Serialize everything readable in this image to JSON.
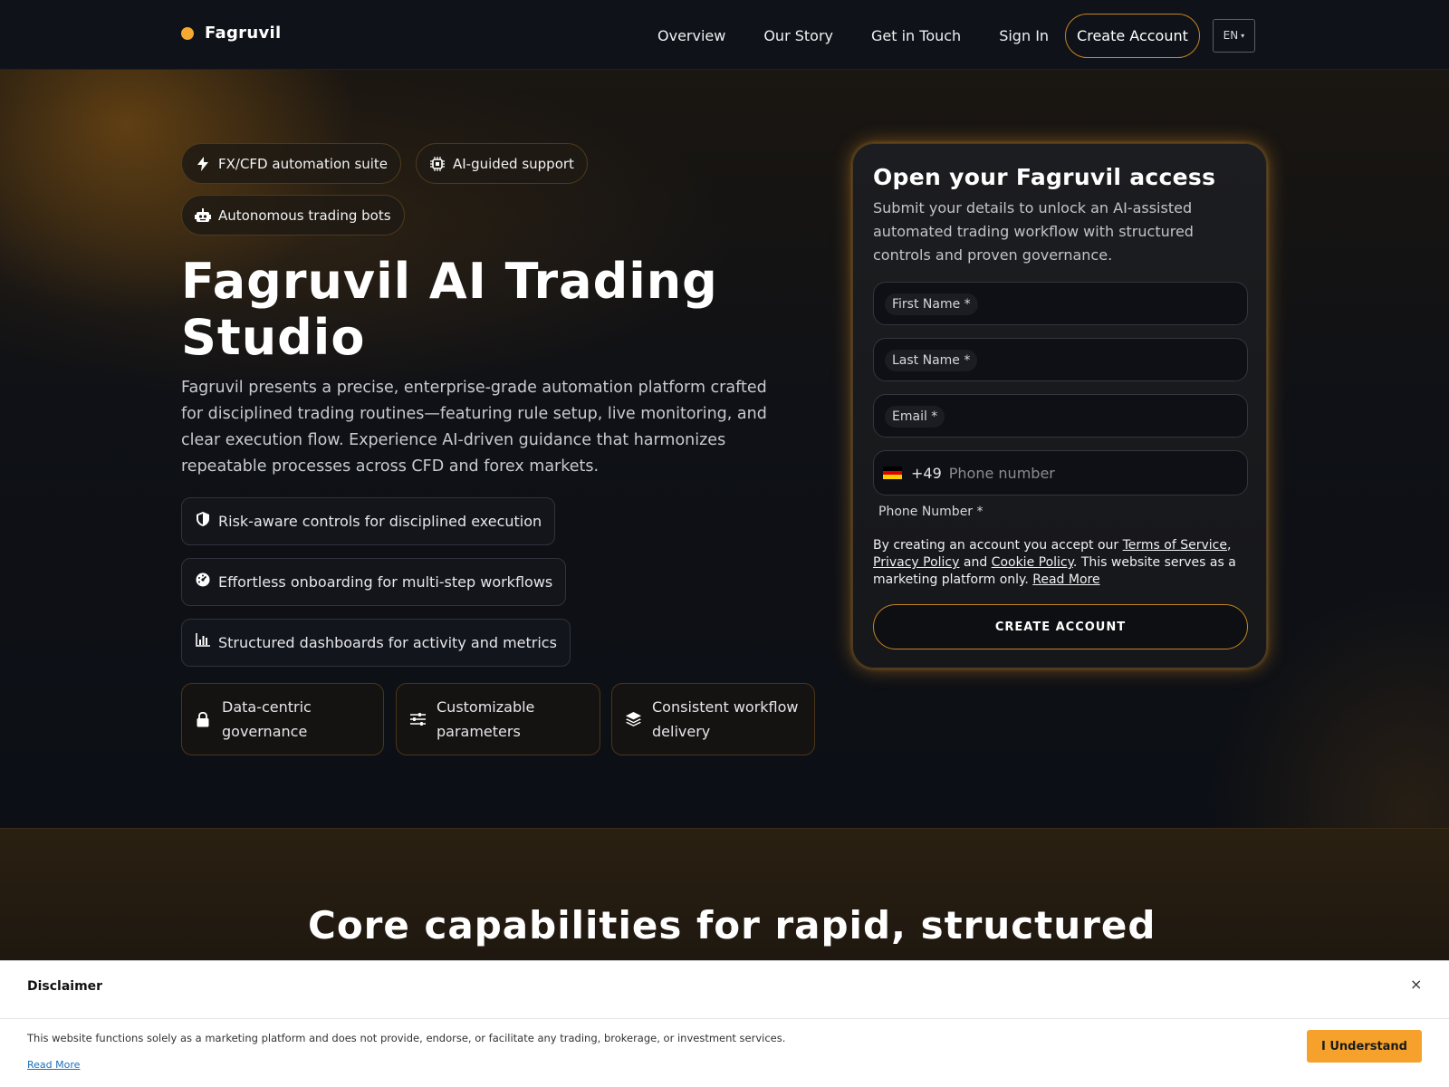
{
  "brand": {
    "name": "Fagruvil",
    "accent": "#f5a832"
  },
  "nav": {
    "links": [
      "Overview",
      "Our Story",
      "Get in Touch",
      "Sign In"
    ],
    "cta": "Create Account",
    "lang": "EN"
  },
  "hero": {
    "chips": [
      {
        "label": "FX/CFD automation suite",
        "icon": "lightning-icon"
      },
      {
        "label": "AI-guided support",
        "icon": "chip-icon"
      },
      {
        "label": "Autonomous trading bots",
        "icon": "robot-icon"
      }
    ],
    "title": "Fagruvil AI Trading Studio",
    "description": "Fagruvil presents a precise, enterprise-grade automation platform crafted for disciplined trading routines—featuring rule setup, live monitoring, and clear execution flow. Experience AI-driven guidance that harmonizes repeatable processes across CFD and forex markets.",
    "features": [
      {
        "label": "Risk-aware controls for disciplined execution",
        "icon": "shield-icon"
      },
      {
        "label": "Effortless onboarding for multi-step workflows",
        "icon": "gauge-icon"
      },
      {
        "label": "Structured dashboards for activity and metrics",
        "icon": "bar-chart-icon"
      }
    ],
    "tiles": [
      {
        "label": "Data-centric governance",
        "icon": "lock-icon"
      },
      {
        "label": "Customizable parameters",
        "icon": "sliders-icon"
      },
      {
        "label": "Consistent workflow delivery",
        "icon": "layers-icon"
      }
    ]
  },
  "form": {
    "title": "Open your Fagruvil access",
    "subtitle": "Submit your details to unlock an AI-assisted automated trading workflow with structured controls and proven governance.",
    "first_name": "First Name *",
    "last_name": "Last Name *",
    "email": "Email *",
    "phone_code": "+49",
    "phone_placeholder": "Phone number",
    "phone_label": "Phone Number *",
    "terms": {
      "prefix": "By creating an account you accept our ",
      "tos": "Terms of Service",
      "comma": ",",
      "privacy": "Privacy Policy",
      "and": " and ",
      "cookie": "Cookie Policy",
      "middle": ". This website serves as a marketing platform only. ",
      "read_more": "Read More"
    },
    "submit": "CREATE ACCOUNT"
  },
  "section2": {
    "title": "Core capabilities for rapid, structured"
  },
  "disclaimer": {
    "title": "Disclaimer",
    "close": "×",
    "text": "This website functions solely as a marketing platform and does not provide, endorse, or facilitate any trading, brokerage, or investment services.",
    "read_more": "Read More",
    "button": "I Understand"
  }
}
